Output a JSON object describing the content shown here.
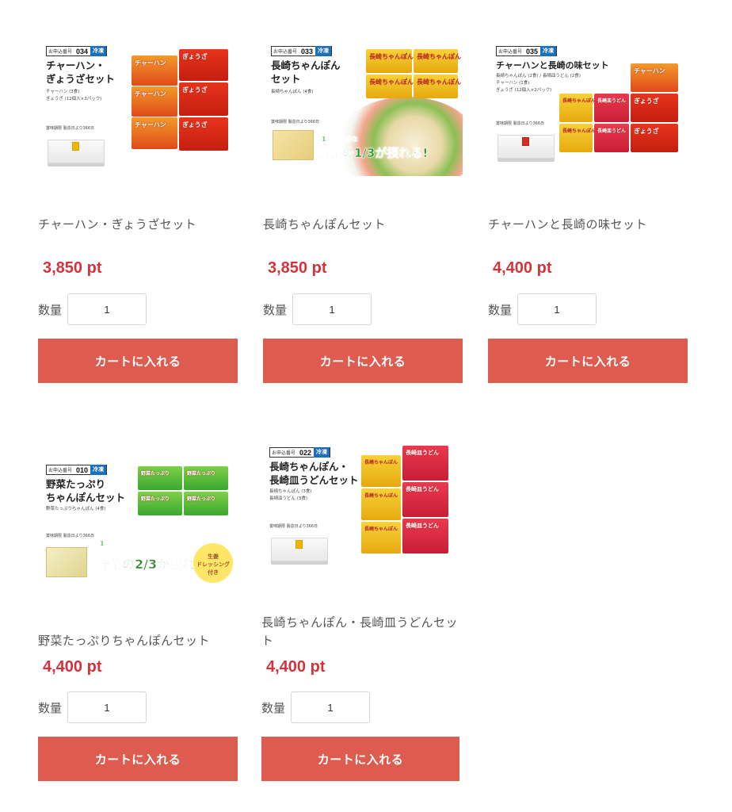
{
  "products": [
    {
      "name": "チャーハン・ぎょうざセット",
      "price": "3,850 pt",
      "qty_label": "数量",
      "qty_value": "1",
      "cart_label": "カートに入れる",
      "image": {
        "order_label": "お申込番号",
        "order_no": "034",
        "frozen": "冷凍",
        "title": "チャーハン・\nぎょうざセット",
        "desc": "チャーハン (3食)\nぎょうざ (12個入×3パック)",
        "best_before": "賞味期限 製造日より366日"
      }
    },
    {
      "name": "長崎ちゃんぽんセット",
      "price": "3,850 pt",
      "qty_label": "数量",
      "qty_value": "1",
      "cart_label": "カートに入れる",
      "image": {
        "order_label": "お申込番号",
        "order_no": "033",
        "frozen": "冷凍",
        "title": "長崎ちゃんぽん\nセット",
        "desc": "長崎ちゃんぽん (4食)",
        "best_before": "賞味期限 製造日より366日",
        "veg_day": "1日に必要な",
        "veg_text": "野菜の1/3が摂れる!"
      }
    },
    {
      "name": "チャーハンと長崎の味セット",
      "price": "4,400 pt",
      "qty_label": "数量",
      "qty_value": "1",
      "cart_label": "カートに入れる",
      "image": {
        "order_label": "お申込番号",
        "order_no": "035",
        "frozen": "冷凍",
        "title": "チャーハンと長崎の味セット",
        "desc": "長崎ちゃんぽん (2食) / 長崎皿うどん (2食)\nチャーハン (1食)\nぎょうざ (12個入×2パック)",
        "best_before": "賞味期限 製造日より366日"
      }
    },
    {
      "name": "野菜たっぷりちゃんぽんセット",
      "price": "4,400 pt",
      "qty_label": "数量",
      "qty_value": "1",
      "cart_label": "カートに入れる",
      "image": {
        "order_label": "お申込番号",
        "order_no": "010",
        "frozen": "冷凍",
        "title": "野菜たっぷり\nちゃんぽんセット",
        "desc": "野菜たっぷりちゃんぽん (4食)",
        "best_before": "賞味期限 製造日より366日",
        "veg_day": "1日に必要な",
        "veg_text": "野菜の2/3が摂れる!",
        "badge": "生姜\nドレッシング\n付き"
      }
    },
    {
      "name": "長崎ちゃんぽん・長崎皿うどんセット",
      "price": "4,400 pt",
      "qty_label": "数量",
      "qty_value": "1",
      "cart_label": "カートに入れる",
      "image": {
        "order_label": "お申込番号",
        "order_no": "022",
        "frozen": "冷凍",
        "title": "長崎ちゃんぽん・\n長崎皿うどんセット",
        "desc": "長崎ちゃんぽん (3食)\n長崎皿うどん (3食)",
        "best_before": "賞味期限 製造日より366日"
      }
    }
  ],
  "colors": {
    "accent": "#dd5c4f",
    "price": "#d5333c",
    "frozen_tag": "#1d6fb8"
  }
}
